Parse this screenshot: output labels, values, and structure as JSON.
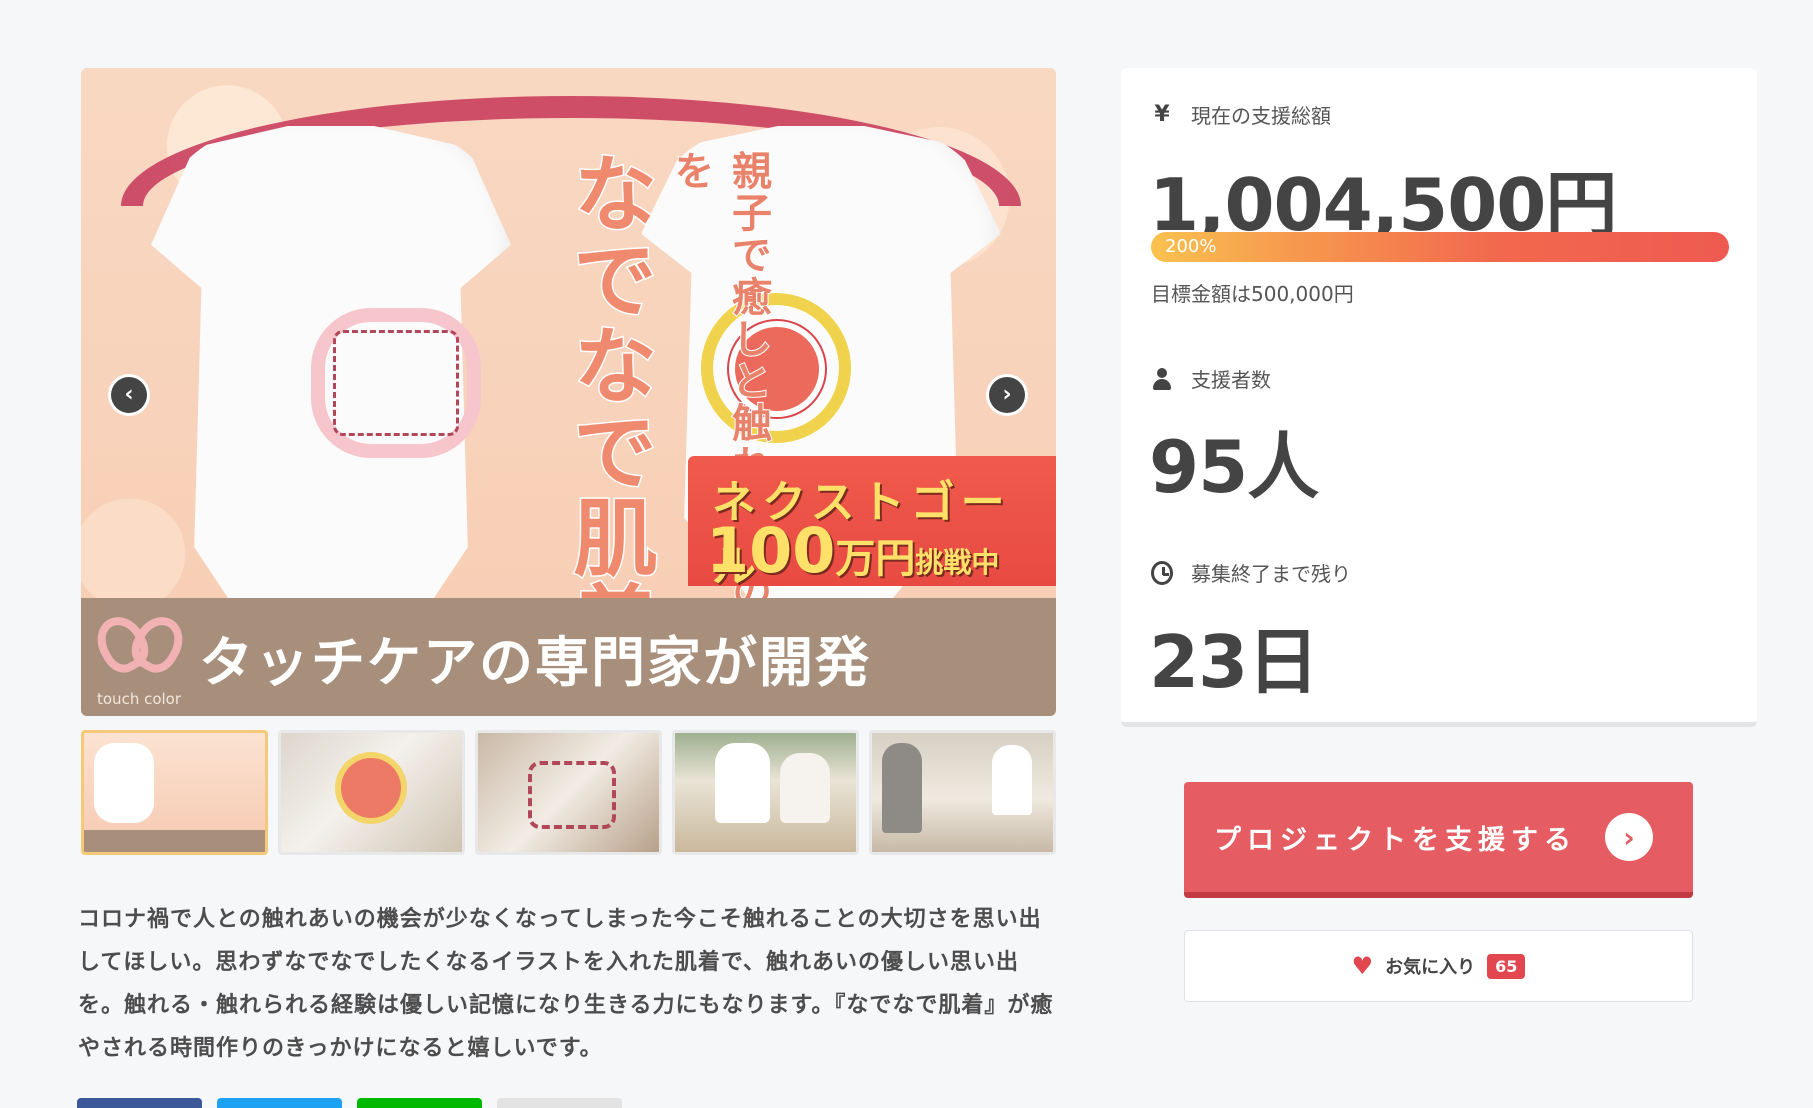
{
  "hero": {
    "title_vertical": "なでなで肌着",
    "subtitle_vertical": "親子で癒しと触れ合いの時間を",
    "next_goal_line1": "ネクストゴール",
    "next_goal_amount": "100",
    "next_goal_unit": "万円",
    "next_goal_tag": "挑戦中",
    "band_text": "タッチケアの専門家が開発",
    "brand_name": "touch color",
    "prev_arrow": "‹",
    "next_arrow": "›"
  },
  "thumbnails": [
    {
      "name": "main visual"
    },
    {
      "name": "onesie on baby"
    },
    {
      "name": "onesie detail"
    },
    {
      "name": "workshop"
    },
    {
      "name": "care session"
    }
  ],
  "description": "コロナ禍で人との触れあいの機会が少なくなってしまった今こそ触れることの大切さを思い出してほしい。思わずなでなでしたくなるイラストを入れた肌着で、触れあいの優しい思い出を。触れる・触れられる経験は優しい記憶になり生きる力にもなります。『なでなで肌着』が癒やされる時間作りのきっかけになると嬉しいです。",
  "stats": {
    "yen_symbol": "¥",
    "amount_label": "現在の支援総額",
    "amount_value": "1,004,500円",
    "progress_percent_text": "200%",
    "progress_percent": 200,
    "goal_note": "目標金額は500,000円",
    "backers_label": "支援者数",
    "backers_value": "95人",
    "remaining_label": "募集終了まで残り",
    "remaining_value": "23日"
  },
  "cta": {
    "support_label": "プロジェクトを支援する",
    "support_arrow": "›",
    "favorite_label": "お気に入り",
    "favorite_heart": "♥",
    "favorite_count": "65"
  },
  "share_buttons": [
    {
      "name": "facebook",
      "color": "#3b5998"
    },
    {
      "name": "twitter",
      "color": "#1da1f2"
    },
    {
      "name": "line",
      "color": "#00b900"
    },
    {
      "name": "copy",
      "color": "#e3e3e3"
    }
  ],
  "colors": {
    "accent": "#e55d62",
    "progress_start": "#f9c24f",
    "progress_end": "#ef5a50",
    "heart": "#e2474f"
  }
}
